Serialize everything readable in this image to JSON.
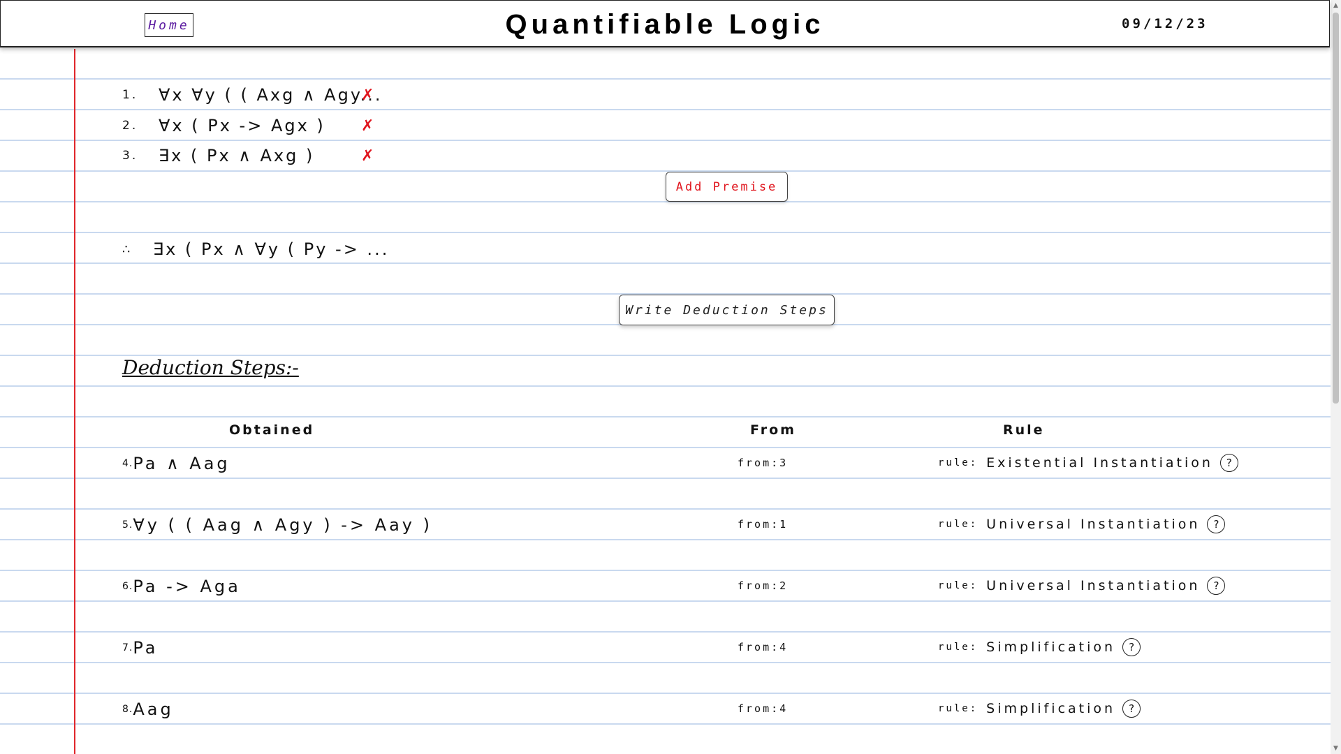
{
  "header": {
    "home_label": "Home",
    "title": "Quantifiable Logic",
    "date": "09/12/23"
  },
  "premises": [
    {
      "number": "1.",
      "formula": "∀x ∀y ( ( Axg ∧ Agy...",
      "remove_icon": "✗"
    },
    {
      "number": "2.",
      "formula": "∀x ( Px -> Agx )",
      "remove_icon": "✗"
    },
    {
      "number": "3.",
      "formula": "∃x ( Px ∧ Axg )",
      "remove_icon": "✗"
    }
  ],
  "add_premise_label": "Add Premise",
  "conclusion": {
    "symbol": "∴",
    "formula": "∃x ( Px ∧ ∀y ( Py -> ..."
  },
  "write_steps_label": "Write Deduction Steps",
  "deduction": {
    "heading": "Deduction Steps:-",
    "columns": {
      "obtained": "Obtained",
      "from": "From",
      "rule": "Rule"
    },
    "rule_prefix": "rule:",
    "help_icon": "?",
    "steps": [
      {
        "number": "4.",
        "formula": "Pa ∧ Aag",
        "from": "from:3",
        "rule": "Existential Instantiation"
      },
      {
        "number": "5.",
        "formula": "∀y ( ( Aag ∧ Agy ) -> Aay )",
        "from": "from:1",
        "rule": "Universal Instantiation"
      },
      {
        "number": "6.",
        "formula": "Pa -> Aga",
        "from": "from:2",
        "rule": "Universal Instantiation"
      },
      {
        "number": "7.",
        "formula": "Pa",
        "from": "from:4",
        "rule": "Simplification"
      },
      {
        "number": "8.",
        "formula": "Aag",
        "from": "from:4",
        "rule": "Simplification"
      }
    ]
  },
  "colors": {
    "margin_line": "#e0262b",
    "ruled_line": "#c9d9ef",
    "remove_icon": "#e0141c",
    "home_text": "#5a1aa0"
  }
}
